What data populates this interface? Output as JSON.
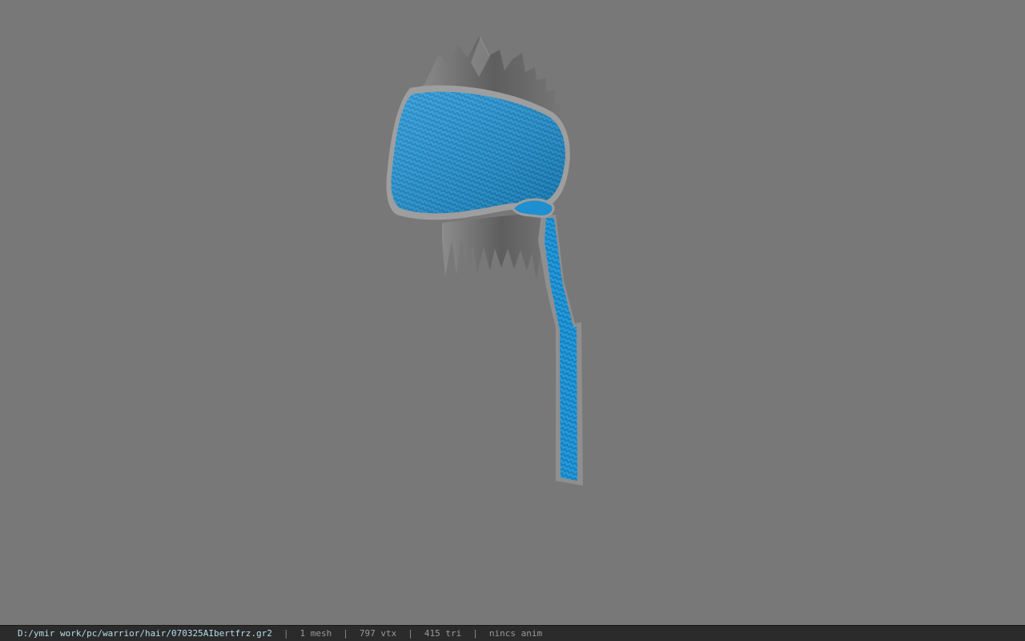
{
  "viewport": {
    "background_color": "#787878",
    "model": {
      "cap_color": "#1e8fd0",
      "spike_color": "#6a6a6a",
      "trim_color": "#9a9a9a"
    }
  },
  "status_bar": {
    "file_path": "D:/ymir work/pc/warrior/hair/070325AIbertfrz.gr2",
    "separator": "|",
    "mesh_count": "1 mesh",
    "vertex_count": "797 vtx",
    "triangle_count": "415 tri",
    "anim_status": "nincs anim"
  }
}
